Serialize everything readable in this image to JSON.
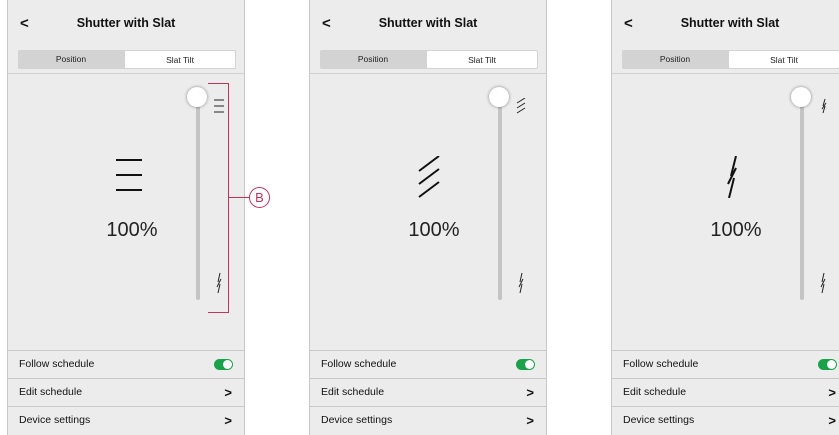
{
  "colors": {
    "toggle_on": "#1aa24a",
    "callout": "#c0335a"
  },
  "callout": {
    "label": "B"
  },
  "screens": [
    {
      "title": "Shutter with Slat",
      "tabs": [
        "Position",
        "Slat Tilt"
      ],
      "active_tab": "Slat Tilt",
      "slat_icon": "slat-horizontal-icon",
      "percent": "100%",
      "slider_value_percent": 100,
      "rows": {
        "follow_schedule": "Follow schedule",
        "edit_schedule": "Edit schedule",
        "device_settings": "Device settings"
      },
      "follow_schedule_on": true
    },
    {
      "title": "Shutter with Slat",
      "tabs": [
        "Position",
        "Slat Tilt"
      ],
      "active_tab": "Slat Tilt",
      "slat_icon": "slat-diagonal-icon",
      "percent": "100%",
      "slider_value_percent": 100,
      "rows": {
        "follow_schedule": "Follow schedule",
        "edit_schedule": "Edit schedule",
        "device_settings": "Device settings"
      },
      "follow_schedule_on": true
    },
    {
      "title": "Shutter with Slat",
      "tabs": [
        "Position",
        "Slat Tilt"
      ],
      "active_tab": "Slat Tilt",
      "slat_icon": "slat-vertical-icon",
      "percent": "100%",
      "slider_value_percent": 100,
      "rows": {
        "follow_schedule": "Follow schedule",
        "edit_schedule": "Edit schedule",
        "device_settings": "Device settings"
      },
      "follow_schedule_on": true
    }
  ]
}
